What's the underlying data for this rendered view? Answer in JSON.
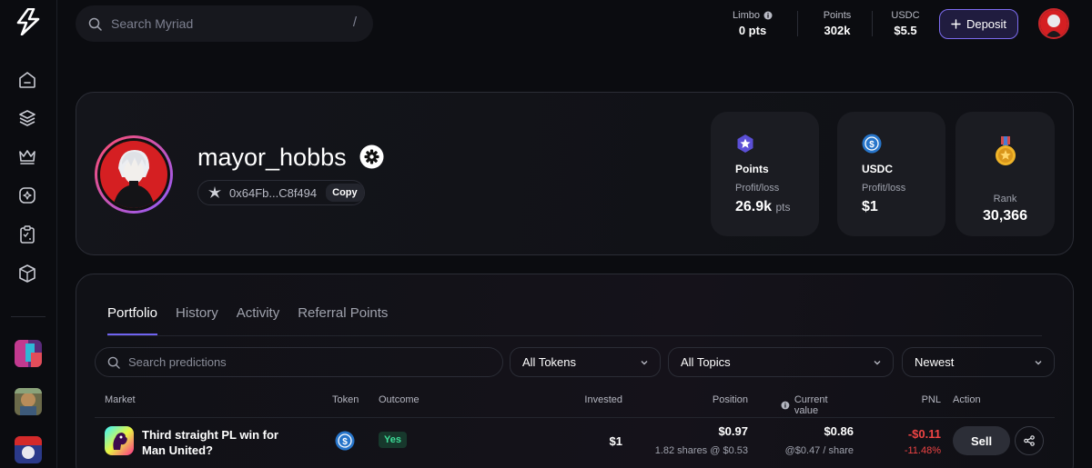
{
  "search": {
    "placeholder": "Search Myriad",
    "shortcut": "/"
  },
  "header_stats": [
    {
      "label": "Limbo",
      "value": "0 pts"
    },
    {
      "label": "Points",
      "value": "302k"
    },
    {
      "label": "USDC",
      "value": "$5.5"
    }
  ],
  "deposit_label": "Deposit",
  "profile": {
    "username": "mayor_hobbs",
    "address": "0x64Fb...C8f494",
    "copy_label": "Copy"
  },
  "stat_cards": {
    "points": {
      "title": "Points",
      "sub": "Profit/loss",
      "value": "26.9k",
      "unit": "pts"
    },
    "usdc": {
      "title": "USDC",
      "sub": "Profit/loss",
      "value": "$1"
    },
    "rank": {
      "sub": "Rank",
      "value": "30,366"
    }
  },
  "tabs": [
    "Portfolio",
    "History",
    "Activity",
    "Referral Points"
  ],
  "filters": {
    "search_placeholder": "Search predictions",
    "tokens": "All Tokens",
    "topics": "All Topics",
    "sort": "Newest"
  },
  "table": {
    "headers": {
      "market": "Market",
      "token": "Token",
      "outcome": "Outcome",
      "invested": "Invested",
      "position": "Position",
      "current_value": "Current value",
      "pnl": "PNL",
      "action": "Action"
    },
    "rows": [
      {
        "market": "Third straight PL win for Man United?",
        "outcome": "Yes",
        "invested": "$1",
        "position": "$0.97",
        "position_sub": "1.82 shares @ $0.53",
        "current_value": "$0.86",
        "current_sub": "@$0.47 / share",
        "pnl": "-$0.11",
        "pnl_pct": "-11.48%",
        "action": "Sell"
      }
    ]
  },
  "colors": {
    "accent": "#6f63ef",
    "negative": "#ef4444",
    "positive": "#3ddc97",
    "usdc": "#2775ca"
  }
}
